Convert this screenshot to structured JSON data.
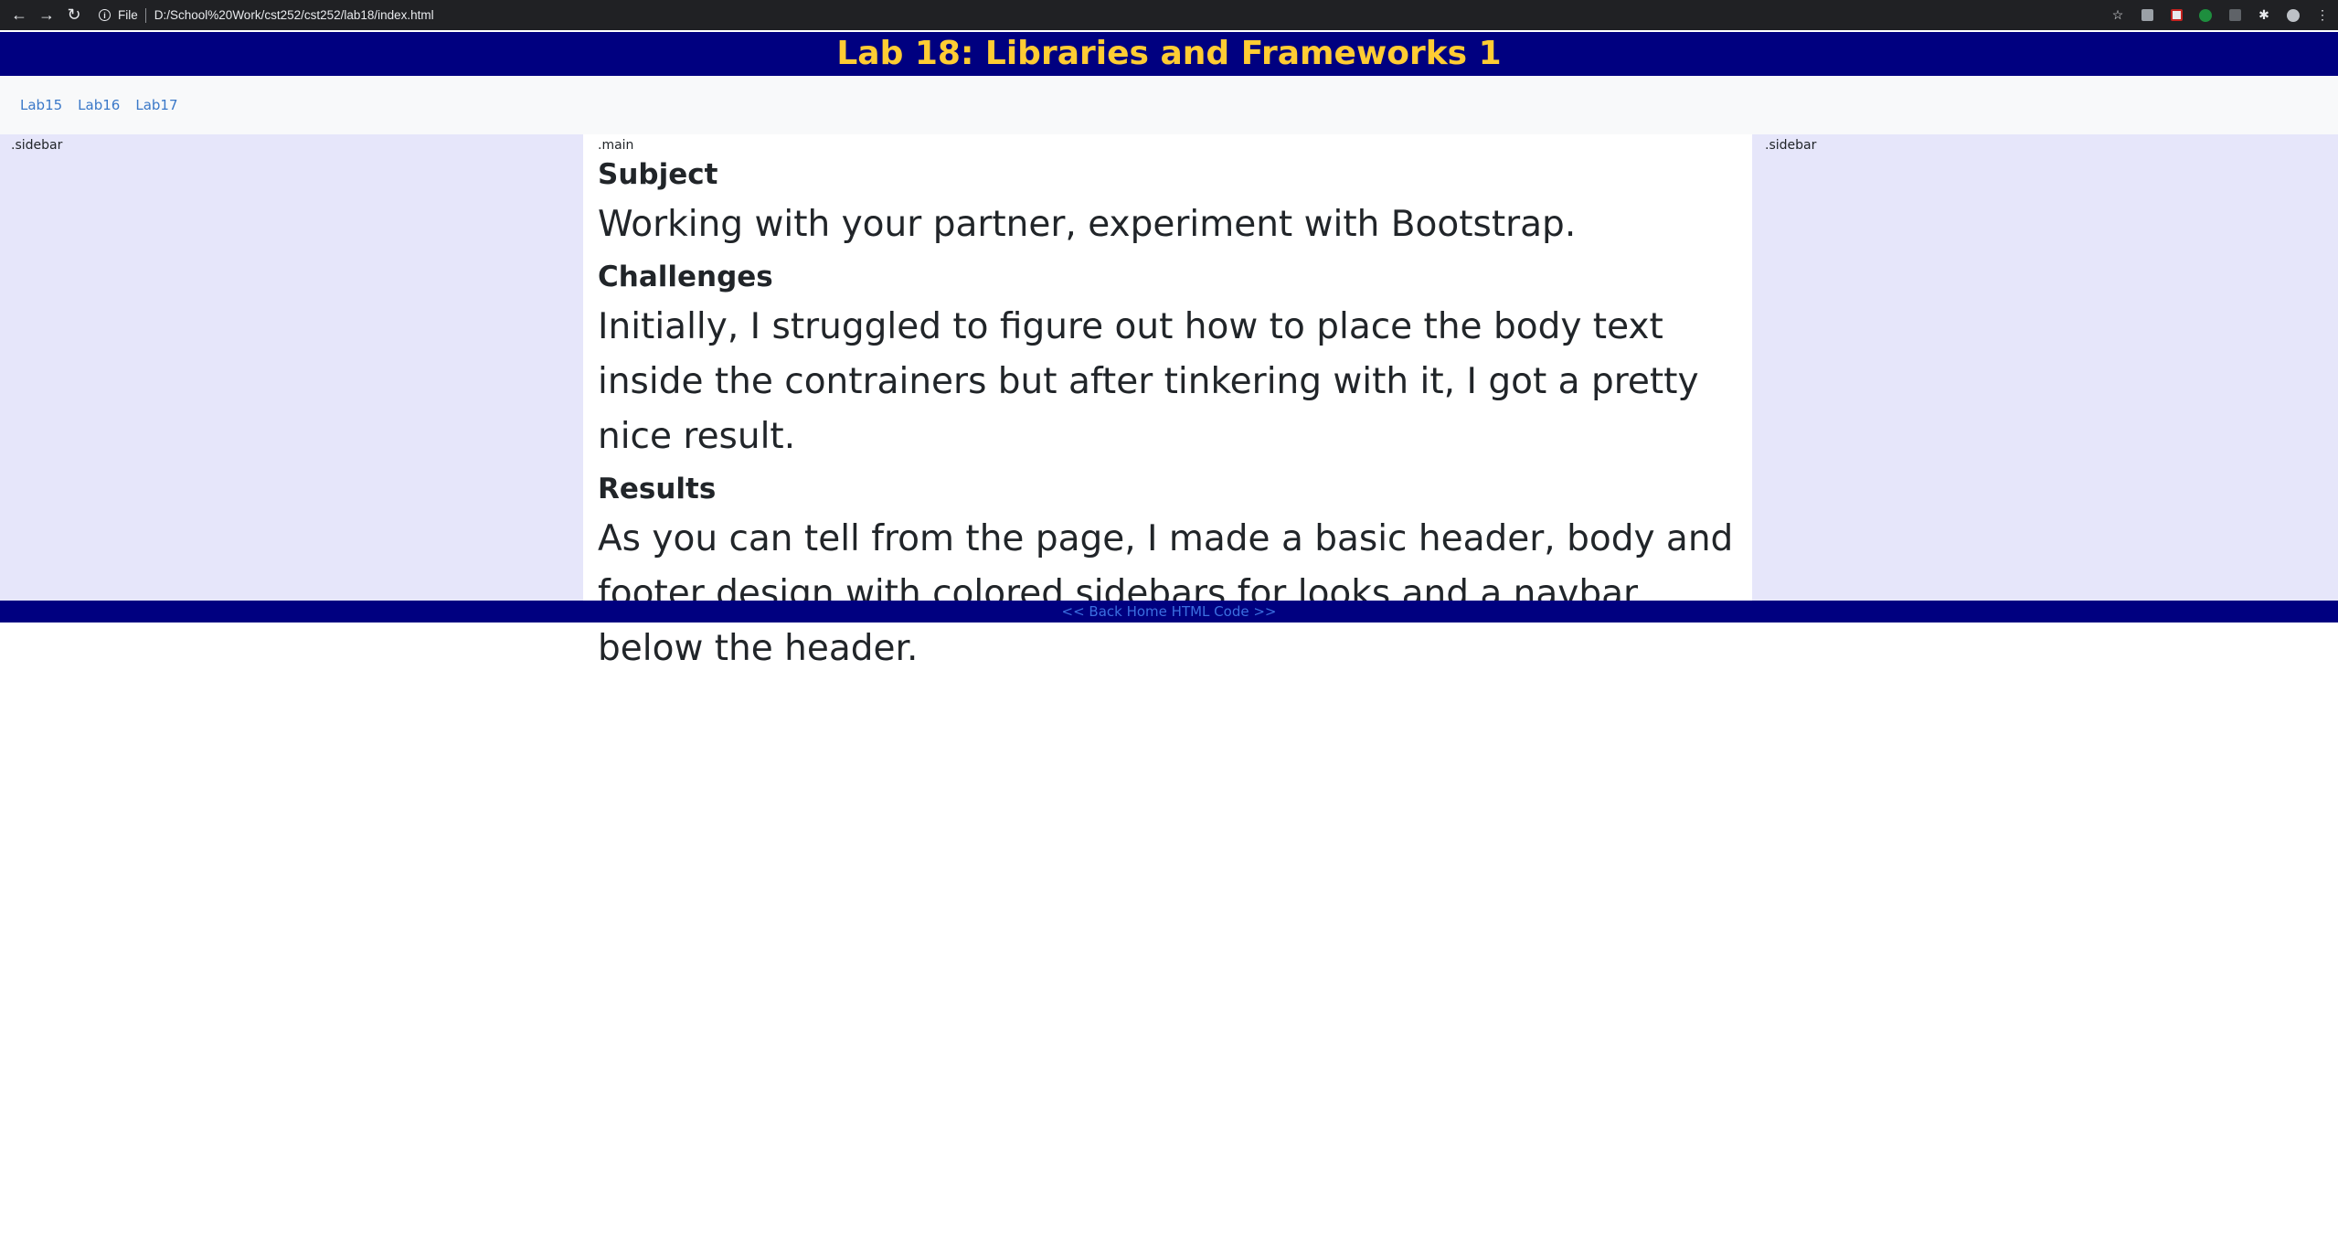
{
  "browser": {
    "url": "D:/School%20Work/cst252/cst252/lab18/index.html",
    "file_label": "File"
  },
  "header": {
    "title": "Lab 18: Libraries and Frameworks 1"
  },
  "navbar": {
    "links": [
      "Lab15",
      "Lab16",
      "Lab17"
    ]
  },
  "sidebar_left": {
    "label": ".sidebar"
  },
  "sidebar_right": {
    "label": ".sidebar"
  },
  "main": {
    "label": ".main",
    "sections": [
      {
        "heading": "Subject",
        "body": "Working with your partner, experiment with Bootstrap."
      },
      {
        "heading": "Challenges",
        "body": "Initially, I struggled to figure out how to place the body text inside the contrainers but after tinkering with it, I got a pretty nice result."
      },
      {
        "heading": "Results",
        "body": "As you can tell from the page, I made a basic header, body and footer design with colored sidebars for looks and a navbar below the header."
      }
    ]
  },
  "footer": {
    "link_text": "<< Back Home HTML Code >>"
  },
  "colors": {
    "header_bg": "#000080",
    "title_color": "#ffcc33",
    "sidebar_bg": "#e6e6fa",
    "navbar_bg": "#f8f9fa",
    "link_color": "#3a78c8"
  }
}
